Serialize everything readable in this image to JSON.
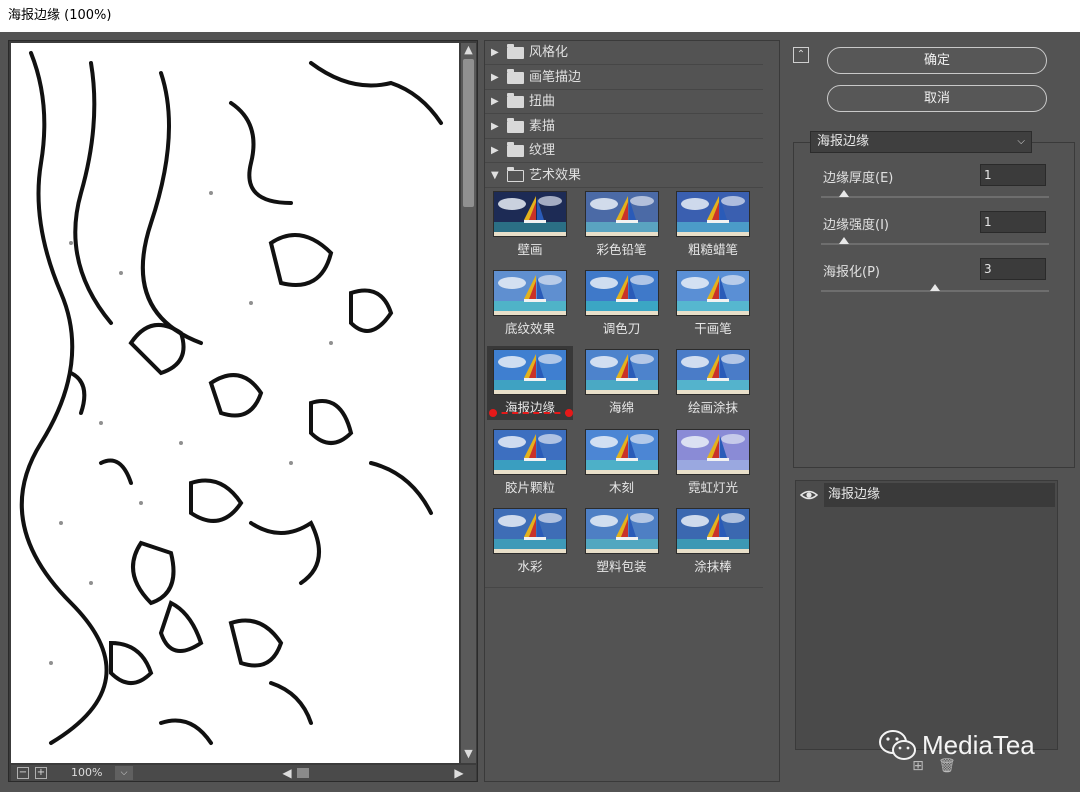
{
  "window": {
    "title": "海报边缘 (100%)"
  },
  "preview": {
    "zoom": "100%",
    "zoom_out_glyph": "−",
    "zoom_in_glyph": "+",
    "scroll_up_glyph": "▲",
    "scroll_down_glyph": "▼",
    "scroll_left_glyph": "◀",
    "scroll_right_glyph": "▶",
    "dropdown_glyph": "⌵"
  },
  "gallery": {
    "categories": [
      {
        "label": "风格化",
        "expanded": false,
        "glyph": "▶"
      },
      {
        "label": "画笔描边",
        "expanded": false,
        "glyph": "▶"
      },
      {
        "label": "扭曲",
        "expanded": false,
        "glyph": "▶"
      },
      {
        "label": "素描",
        "expanded": false,
        "glyph": "▶"
      },
      {
        "label": "纹理",
        "expanded": false,
        "glyph": "▶"
      },
      {
        "label": "艺术效果",
        "expanded": true,
        "glyph": "▼"
      }
    ],
    "thumbnails": [
      {
        "label": "壁画"
      },
      {
        "label": "彩色铅笔"
      },
      {
        "label": "粗糙蜡笔"
      },
      {
        "label": "底纹效果"
      },
      {
        "label": "调色刀"
      },
      {
        "label": "干画笔"
      },
      {
        "label": "海报边缘",
        "selected": true
      },
      {
        "label": "海绵"
      },
      {
        "label": "绘画涂抹"
      },
      {
        "label": "胶片颗粒"
      },
      {
        "label": "木刻"
      },
      {
        "label": "霓虹灯光"
      },
      {
        "label": "水彩"
      },
      {
        "label": "塑料包装"
      },
      {
        "label": "涂抹棒"
      }
    ]
  },
  "actions": {
    "collapse_glyph": "⌃",
    "ok_label": "确定",
    "cancel_label": "取消"
  },
  "settings": {
    "filter_select": "海报边缘",
    "select_chevron": "⌵",
    "params": [
      {
        "label": "边缘厚度(E)",
        "value": "1",
        "level": 0.1
      },
      {
        "label": "边缘强度(I)",
        "value": "1",
        "level": 0.1
      },
      {
        "label": "海报化(P)",
        "value": "3",
        "level": 0.5
      }
    ]
  },
  "layers": {
    "items": [
      {
        "name": "海报边缘",
        "visible": true
      }
    ],
    "new_glyph": "⊞",
    "delete_glyph": "🗑"
  },
  "watermark": {
    "text": "MediaTea"
  },
  "colors": {
    "background": "#535353",
    "selection": "#383838",
    "marker_red": "#e51919",
    "layer_highlight": "#3a3a3a"
  }
}
